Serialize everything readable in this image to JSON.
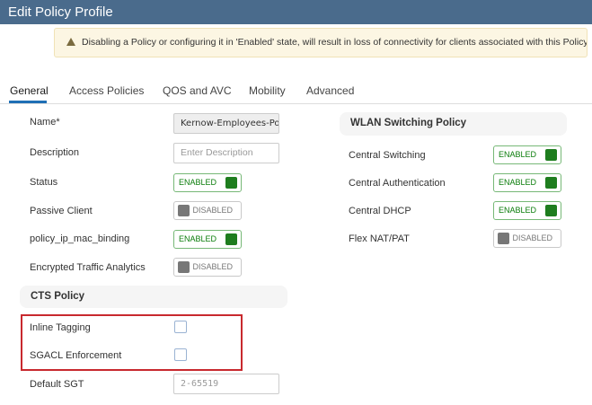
{
  "header": {
    "title": "Edit Policy Profile"
  },
  "warning": {
    "text": "Disabling a Policy or configuring it in 'Enabled' state, will result in loss of connectivity for clients associated with this Policy profile."
  },
  "tabs": [
    "General",
    "Access Policies",
    "QOS and AVC",
    "Mobility",
    "Advanced"
  ],
  "active_tab": "General",
  "general": {
    "name_label": "Name*",
    "name_value": "Kernow-Employees-Poli",
    "description_label": "Description",
    "description_placeholder": "Enter Description",
    "status_label": "Status",
    "status_value": "ENABLED",
    "passive_client_label": "Passive Client",
    "passive_client_value": "DISABLED",
    "policy_ip_mac_binding_label": "policy_ip_mac_binding",
    "policy_ip_mac_binding_value": "ENABLED",
    "eta_label": "Encrypted Traffic Analytics",
    "eta_value": "DISABLED"
  },
  "cts": {
    "title": "CTS Policy",
    "inline_tagging_label": "Inline Tagging",
    "sgacl_label": "SGACL Enforcement",
    "default_sgt_label": "Default SGT",
    "default_sgt_placeholder": "2-65519"
  },
  "wlan": {
    "title": "WLAN Switching Policy",
    "central_switching_label": "Central Switching",
    "central_switching_value": "ENABLED",
    "central_auth_label": "Central Authentication",
    "central_auth_value": "ENABLED",
    "central_dhcp_label": "Central DHCP",
    "central_dhcp_value": "ENABLED",
    "flex_nat_label": "Flex NAT/PAT",
    "flex_nat_value": "DISABLED"
  },
  "colors": {
    "header_bg": "#4a6b8c",
    "enabled_green": "#1e7d1e",
    "active_tab_underline": "#1f6fb5",
    "highlight_red": "#c8292e"
  }
}
